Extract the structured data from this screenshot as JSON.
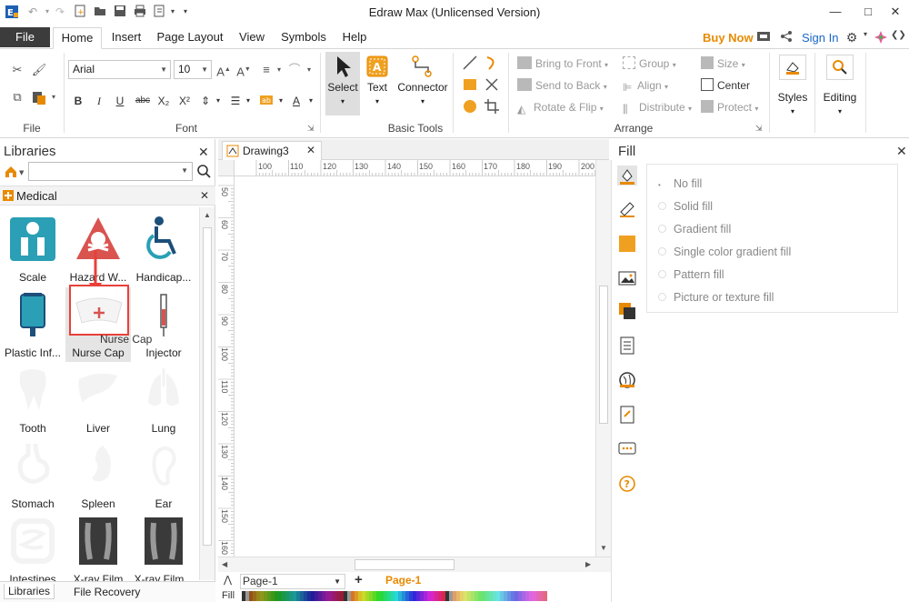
{
  "window": {
    "title": "Edraw Max (Unlicensed Version)",
    "min": "—",
    "max": "□",
    "close": "✕"
  },
  "menu": {
    "file": "File",
    "tabs": [
      "Home",
      "Insert",
      "Page Layout",
      "View",
      "Symbols",
      "Help"
    ],
    "buy_now": "Buy Now",
    "sign_in": "Sign In"
  },
  "ribbon": {
    "groups": {
      "file": "File",
      "font": "Font",
      "basic_tools": "Basic Tools",
      "arrange": "Arrange"
    },
    "font_name": "Arial",
    "font_size": "10",
    "format_buttons": [
      "B",
      "I",
      "U",
      "abc",
      "X₂",
      "X²"
    ],
    "tools": {
      "select": "Select",
      "text": "Text",
      "connector": "Connector"
    },
    "arrange": {
      "bring_to_front": "Bring to Front",
      "send_to_back": "Send to Back",
      "rotate_flip": "Rotate & Flip",
      "group": "Group",
      "align": "Align",
      "distribute": "Distribute",
      "size": "Size",
      "center": "Center",
      "protect": "Protect"
    },
    "styles": "Styles",
    "editing": "Editing"
  },
  "libraries": {
    "title": "Libraries",
    "search_value": "",
    "category": "Medical",
    "items": [
      {
        "label": "Scale"
      },
      {
        "label": "Hazard W..."
      },
      {
        "label": "Handicap..."
      },
      {
        "label": "Plastic Inf..."
      },
      {
        "label": "Nurse Cap"
      },
      {
        "label": "Injector"
      },
      {
        "label": "Tooth"
      },
      {
        "label": "Liver"
      },
      {
        "label": "Lung"
      },
      {
        "label": "Stomach"
      },
      {
        "label": "Spleen"
      },
      {
        "label": "Ear"
      },
      {
        "label": "Intestines"
      },
      {
        "label": "X-ray Film"
      },
      {
        "label": "X-ray Film..."
      }
    ],
    "drag_tooltip": "Nurse Cap",
    "bottom_tabs": [
      "Libraries",
      "File Recovery"
    ]
  },
  "document": {
    "tab": "Drawing3",
    "ruler_top": [
      "100",
      "110",
      "120",
      "130",
      "140",
      "150",
      "160",
      "170",
      "180",
      "190",
      "200"
    ],
    "ruler_left": [
      "50",
      "60",
      "70",
      "80",
      "90",
      "100",
      "110",
      "120",
      "130",
      "140",
      "150",
      "160"
    ],
    "page_combo": "Page-1",
    "page_tab": "Page-1",
    "palette_label": "Fill"
  },
  "fill": {
    "title": "Fill",
    "options": [
      "No fill",
      "Solid fill",
      "Gradient fill",
      "Single color gradient fill",
      "Pattern fill",
      "Picture or texture fill"
    ],
    "selected": "No fill"
  },
  "colors": {
    "accent": "#e88a00",
    "link": "#1a66c9",
    "teal": "#2a9fb5",
    "hazard": "#d9534f",
    "drag_box": "#e8403a"
  }
}
